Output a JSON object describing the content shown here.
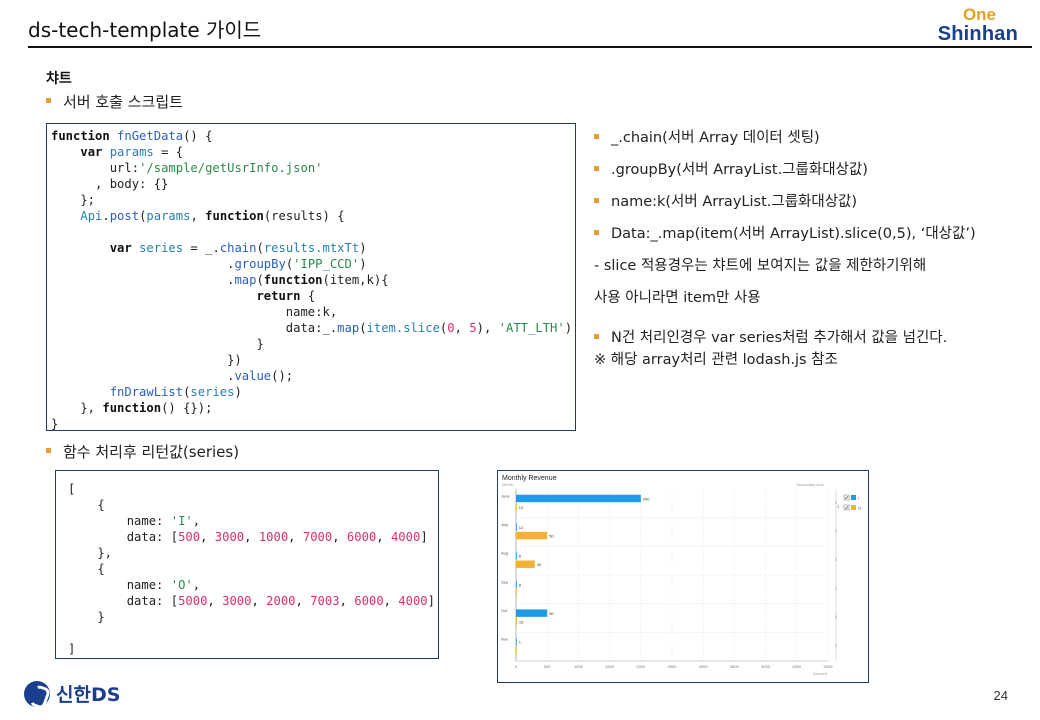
{
  "header": {
    "title": "ds-tech-template 가이드",
    "logo_one": "One",
    "logo_shinhan": "Shinhan"
  },
  "section": {
    "title": "챠트",
    "bullet_server_script": "서버 호출 스크립트",
    "bullet_return_value": "함수 처리후 리턴값(series)"
  },
  "code_main": [
    [
      {
        "c": "kw",
        "t": "function "
      },
      {
        "c": "fn",
        "t": "fnGetData"
      },
      {
        "c": "tx",
        "t": "() {"
      }
    ],
    [
      {
        "c": "tx",
        "t": "    "
      },
      {
        "c": "kw",
        "t": "var "
      },
      {
        "c": "pr",
        "t": "params"
      },
      {
        "c": "tx",
        "t": " = {"
      }
    ],
    [
      {
        "c": "tx",
        "t": "        url:"
      },
      {
        "c": "st",
        "t": "'/sample/getUsrInfo.json'"
      }
    ],
    [
      {
        "c": "tx",
        "t": "      , body: {}"
      }
    ],
    [
      {
        "c": "tx",
        "t": "    };"
      }
    ],
    [
      {
        "c": "tx",
        "t": "    "
      },
      {
        "c": "pr",
        "t": "Api"
      },
      {
        "c": "tx",
        "t": "."
      },
      {
        "c": "fn",
        "t": "post"
      },
      {
        "c": "tx",
        "t": "("
      },
      {
        "c": "pr",
        "t": "params"
      },
      {
        "c": "tx",
        "t": ", "
      },
      {
        "c": "kw",
        "t": "function"
      },
      {
        "c": "tx",
        "t": "(results) {"
      }
    ],
    [
      {
        "c": "tx",
        "t": ""
      }
    ],
    [
      {
        "c": "tx",
        "t": "        "
      },
      {
        "c": "kw",
        "t": "var "
      },
      {
        "c": "pr",
        "t": "series"
      },
      {
        "c": "tx",
        "t": " = _."
      },
      {
        "c": "fn",
        "t": "chain"
      },
      {
        "c": "tx",
        "t": "("
      },
      {
        "c": "pr",
        "t": "results.mtxTt"
      },
      {
        "c": "tx",
        "t": ")"
      }
    ],
    [
      {
        "c": "tx",
        "t": "                        ."
      },
      {
        "c": "fn",
        "t": "groupBy"
      },
      {
        "c": "tx",
        "t": "("
      },
      {
        "c": "st",
        "t": "'IPP_CCD'"
      },
      {
        "c": "tx",
        "t": ")"
      }
    ],
    [
      {
        "c": "tx",
        "t": "                        ."
      },
      {
        "c": "fn",
        "t": "map"
      },
      {
        "c": "tx",
        "t": "("
      },
      {
        "c": "kw",
        "t": "function"
      },
      {
        "c": "tx",
        "t": "(item,k){"
      }
    ],
    [
      {
        "c": "tx",
        "t": "                            "
      },
      {
        "c": "kw",
        "t": "return"
      },
      {
        "c": "tx",
        "t": " {"
      }
    ],
    [
      {
        "c": "tx",
        "t": "                                name:k,"
      }
    ],
    [
      {
        "c": "tx",
        "t": "                                data:_."
      },
      {
        "c": "fn",
        "t": "map"
      },
      {
        "c": "tx",
        "t": "("
      },
      {
        "c": "pr",
        "t": "item.slice"
      },
      {
        "c": "tx",
        "t": "("
      },
      {
        "c": "nm",
        "t": "0"
      },
      {
        "c": "tx",
        "t": ", "
      },
      {
        "c": "nm",
        "t": "5"
      },
      {
        "c": "tx",
        "t": "), "
      },
      {
        "c": "st",
        "t": "'ATT_LTH'"
      },
      {
        "c": "tx",
        "t": ")"
      }
    ],
    [
      {
        "c": "tx",
        "t": "                            }"
      }
    ],
    [
      {
        "c": "tx",
        "t": "                        })"
      }
    ],
    [
      {
        "c": "tx",
        "t": "                        ."
      },
      {
        "c": "fn",
        "t": "value"
      },
      {
        "c": "tx",
        "t": "();"
      }
    ],
    [
      {
        "c": "tx",
        "t": "        "
      },
      {
        "c": "fn",
        "t": "fnDrawList"
      },
      {
        "c": "tx",
        "t": "("
      },
      {
        "c": "pr",
        "t": "series"
      },
      {
        "c": "tx",
        "t": ")"
      }
    ],
    [
      {
        "c": "tx",
        "t": "    }, "
      },
      {
        "c": "kw",
        "t": "function"
      },
      {
        "c": "tx",
        "t": "() {});"
      }
    ],
    [
      {
        "c": "tx",
        "t": "}"
      }
    ]
  ],
  "code_result": [
    [
      {
        "c": "tx",
        "t": "["
      }
    ],
    [
      {
        "c": "tx",
        "t": "    {"
      }
    ],
    [
      {
        "c": "tx",
        "t": "        name: "
      },
      {
        "c": "st",
        "t": "'I'"
      },
      {
        "c": "tx",
        "t": ","
      }
    ],
    [
      {
        "c": "tx",
        "t": "        data: ["
      },
      {
        "c": "nm",
        "t": "500"
      },
      {
        "c": "tx",
        "t": ", "
      },
      {
        "c": "nm",
        "t": "3000"
      },
      {
        "c": "tx",
        "t": ", "
      },
      {
        "c": "nm",
        "t": "1000"
      },
      {
        "c": "tx",
        "t": ", "
      },
      {
        "c": "nm",
        "t": "7000"
      },
      {
        "c": "tx",
        "t": ", "
      },
      {
        "c": "nm",
        "t": "6000"
      },
      {
        "c": "tx",
        "t": ", "
      },
      {
        "c": "nm",
        "t": "4000"
      },
      {
        "c": "tx",
        "t": "]"
      }
    ],
    [
      {
        "c": "tx",
        "t": "    },"
      }
    ],
    [
      {
        "c": "tx",
        "t": "    {"
      }
    ],
    [
      {
        "c": "tx",
        "t": "        name: "
      },
      {
        "c": "st",
        "t": "'O'"
      },
      {
        "c": "tx",
        "t": ","
      }
    ],
    [
      {
        "c": "tx",
        "t": "        data: ["
      },
      {
        "c": "nm",
        "t": "5000"
      },
      {
        "c": "tx",
        "t": ", "
      },
      {
        "c": "nm",
        "t": "3000"
      },
      {
        "c": "tx",
        "t": ", "
      },
      {
        "c": "nm",
        "t": "2000"
      },
      {
        "c": "tx",
        "t": ", "
      },
      {
        "c": "nm",
        "t": "7003"
      },
      {
        "c": "tx",
        "t": ", "
      },
      {
        "c": "nm",
        "t": "6000"
      },
      {
        "c": "tx",
        "t": ", "
      },
      {
        "c": "nm",
        "t": "4000"
      },
      {
        "c": "tx",
        "t": "]"
      }
    ],
    [
      {
        "c": "tx",
        "t": "    }"
      }
    ],
    [
      {
        "c": "tx",
        "t": ""
      }
    ],
    [
      {
        "c": "tx",
        "t": "]"
      }
    ]
  ],
  "notes": [
    {
      "bullet": true,
      "text": "_.chain(서버 Array 데이터 셋팅)"
    },
    {
      "bullet": true,
      "text": ".groupBy(서버 ArrayList.그룹화대상값)"
    },
    {
      "bullet": true,
      "text": "name:k(서버 ArrayList.그룹화대상값)"
    },
    {
      "bullet": true,
      "text": "Data:_.map(item(서버 ArrayList).slice(0,5), ‘대상값’)"
    },
    {
      "bullet": false,
      "text": "  - slice 적용경우는 챠트에 보여지는 값을 제한하기위해"
    },
    {
      "bullet": false,
      "text": "    사용 아니라면 item만 사용"
    },
    {
      "bullet": true,
      "text": "N건 처리인경우 var series처럼 추가해서 값을 넘긴다."
    },
    {
      "bullet": false,
      "text": "※ 해당 array처리 관련 lodash.js 참조"
    }
  ],
  "chart_data": {
    "type": "bar",
    "orientation": "horizontal",
    "title": "Monthly Revenue",
    "subtitle": "Month",
    "xlabel": "Amount",
    "secondary_axis_label": "Secondary Axis",
    "categories": [
      "June",
      "July",
      "Aug",
      "Sep",
      "Oct",
      "Nov"
    ],
    "xlim": [
      0,
      5000
    ],
    "xticks": [
      0,
      500,
      1000,
      1500,
      2000,
      2500,
      3000,
      3500,
      4000,
      4500,
      5000
    ],
    "secondary_ticks": [
      "1",
      "1",
      "1",
      "1",
      "1",
      "1"
    ],
    "legend_position": "top-right",
    "legend_header": "1",
    "series": [
      {
        "name": "I",
        "color": "#1e9be8",
        "values": [
          2000,
          12,
          8,
          8,
          500,
          1
        ],
        "labels": [
          "200",
          "12",
          "8",
          "8",
          "50",
          "1"
        ]
      },
      {
        "name": "O",
        "color": "#f5b133",
        "values": [
          12,
          500,
          300,
          1,
          15,
          0
        ],
        "labels": [
          "12",
          "50",
          "30",
          "",
          "15",
          ""
        ]
      }
    ]
  },
  "footer": {
    "company": "신한DS",
    "page_number": "24"
  }
}
